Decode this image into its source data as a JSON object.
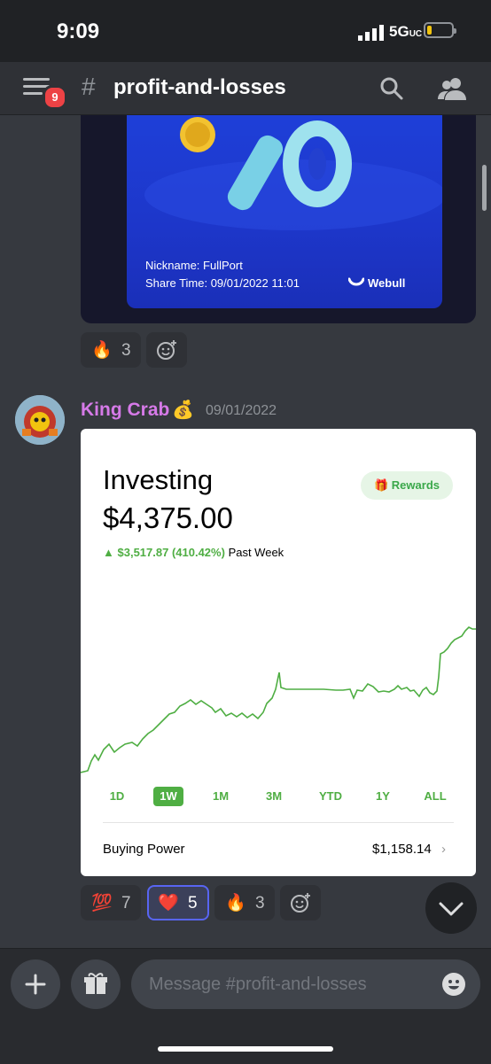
{
  "status_bar": {
    "time": "9:09",
    "network": "5G",
    "network_sub": "UC"
  },
  "header": {
    "hash": "#",
    "channel": "profit-and-losses",
    "badge_count": "9"
  },
  "webull_card": {
    "nickname": "Nickname: FullPort",
    "share_time": "Share Time: 09/01/2022 11:01",
    "brand": "Webull"
  },
  "reactions_1": [
    {
      "emoji": "🔥",
      "count": "3"
    }
  ],
  "message": {
    "author": "King Crab",
    "author_emoji": "💰",
    "timestamp": "09/01/2022"
  },
  "robinhood": {
    "title": "Investing",
    "value": "$4,375.00",
    "rewards_label": "Rewards",
    "rewards_icon": "🎁",
    "change_arrow": "▲",
    "change": "$3,517.87 (410.42%)",
    "change_period": "Past Week",
    "ranges": [
      "1D",
      "1W",
      "1M",
      "3M",
      "YTD",
      "1Y",
      "ALL"
    ],
    "selected_range": "1W",
    "buying_power_label": "Buying Power",
    "buying_power_value": "$1,158.14",
    "chevron": "›",
    "accent_color": "#4fae43"
  },
  "reactions_2": [
    {
      "emoji": "💯",
      "count": "7"
    },
    {
      "emoji": "❤️",
      "count": "5"
    },
    {
      "emoji": "🔥",
      "count": "3"
    }
  ],
  "composer": {
    "placeholder": "Message #profit-and-losses"
  },
  "colors": {
    "background": "#36393f",
    "header": "#2f3136",
    "author": "#d67ae8",
    "brand_blurple": "#5865f2"
  }
}
